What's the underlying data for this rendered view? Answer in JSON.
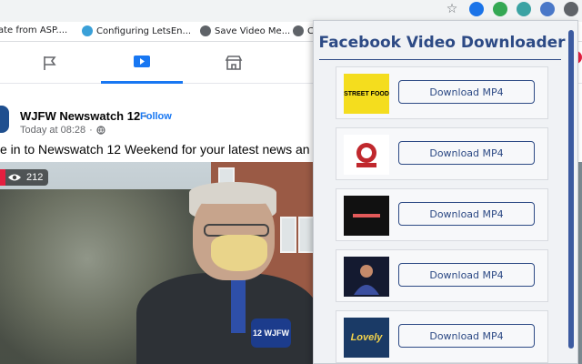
{
  "browser": {
    "bookmarks": [
      {
        "label": "ate from ASP....",
        "color": "#ffffff"
      },
      {
        "label": "Configuring LetsEn...",
        "color": "#3aa0d8"
      },
      {
        "label": "Save Video Me...",
        "color": "#5f6368"
      },
      {
        "label": "C",
        "color": "#5f6368"
      }
    ],
    "star_icon": "☆"
  },
  "facebook": {
    "notification_count": "1",
    "post": {
      "page_name": "WJFW Newswatch 12",
      "follow_label": "Follow",
      "dot": "·",
      "time": "Today at 08:28",
      "text": "e in to Newswatch 12 Weekend for your latest news an"
    },
    "video": {
      "views": "212",
      "mic_label": "12 WJFW"
    }
  },
  "popup": {
    "title": "Facebook Video Downloader",
    "items": [
      {
        "thumb_text": "STREET FOOD",
        "button": "Download MP4"
      },
      {
        "thumb_text": "",
        "button": "Download MP4"
      },
      {
        "thumb_text": "",
        "button": "Download MP4"
      },
      {
        "thumb_text": "",
        "button": "Download MP4"
      },
      {
        "thumb_text": "Lovely",
        "button": "Download MP4"
      }
    ]
  }
}
